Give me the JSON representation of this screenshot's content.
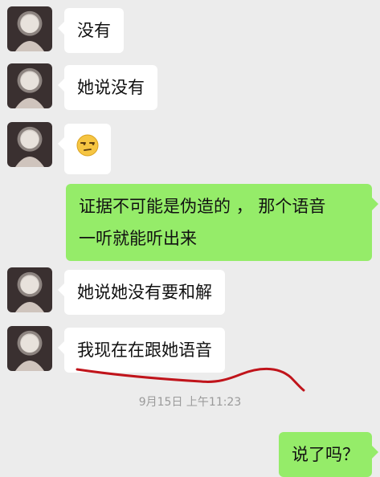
{
  "messages": [
    {
      "side": "left",
      "text": "没有"
    },
    {
      "side": "left",
      "text": "她说没有"
    },
    {
      "side": "left",
      "emoji": "unamused-face-emoji"
    },
    {
      "side": "right",
      "line1": "证据不可能是伪造的 ， 那个语音",
      "line2": "一听就能听出来"
    },
    {
      "side": "left",
      "text": "她说她没有要和解"
    },
    {
      "side": "left",
      "text": "我现在在跟她语音"
    },
    {
      "side": "right",
      "text": "说了吗？"
    }
  ],
  "timestamp": "9月15日 上午11:23",
  "colors": {
    "background": "#ececec",
    "bubble_left": "#ffffff",
    "bubble_right": "#95ec69",
    "annotation_stroke": "#c0141b"
  }
}
